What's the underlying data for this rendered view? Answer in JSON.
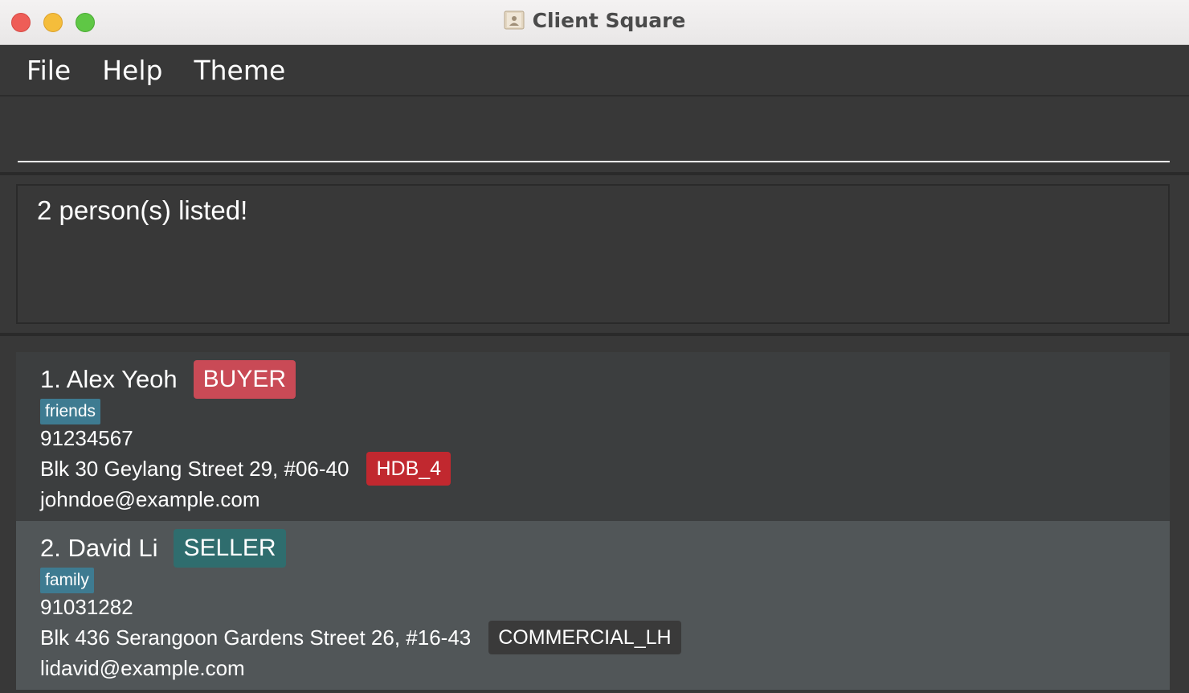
{
  "window": {
    "title": "Client Square",
    "icon": "contacts-app-icon"
  },
  "menu": {
    "items": [
      "File",
      "Help",
      "Theme"
    ]
  },
  "command": {
    "value": "",
    "placeholder": ""
  },
  "result": {
    "message": "2 person(s) listed!"
  },
  "persons": [
    {
      "index_name": "1. Alex Yeoh",
      "role": "BUYER",
      "role_color": "#c94a56",
      "tags": [
        "friends"
      ],
      "phone": "91234567",
      "address": "Blk 30 Geylang Street 29, #06-40",
      "property": "HDB_4",
      "property_color": "#c1282f",
      "email": "johndoe@example.com"
    },
    {
      "index_name": "2. David Li",
      "role": "SELLER",
      "role_color": "#2f6d6e",
      "tags": [
        "family"
      ],
      "phone": "91031282",
      "address": "Blk 436 Serangoon Gardens Street 26, #16-43",
      "property": "COMMERCIAL_LH",
      "property_color": "#3a3a3a",
      "email": "lidavid@example.com"
    }
  ],
  "colors": {
    "background": "#383838",
    "tag": "#3e7b91",
    "card_odd": "#3c3e3f",
    "card_even": "#515658"
  }
}
